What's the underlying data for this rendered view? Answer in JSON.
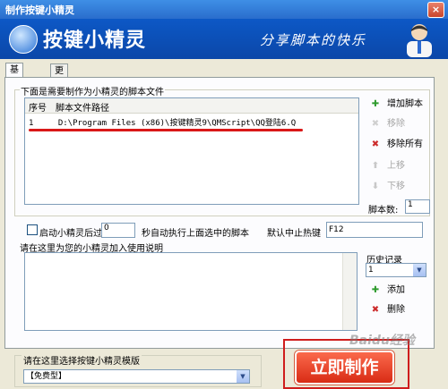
{
  "window": {
    "title": "制作按键小精灵",
    "close_glyph": "×"
  },
  "banner": {
    "app_name": "按键小精灵",
    "slogan": "分享脚本的快乐"
  },
  "tabs": [
    {
      "label": "基本信息",
      "active": true
    },
    {
      "label": "更多设置",
      "active": false
    }
  ],
  "scripts": {
    "group_title": "下面是需要制作为小精灵的脚本文件",
    "columns": [
      "序号",
      "脚本文件路径"
    ],
    "rows": [
      {
        "index": "1",
        "path": "D:\\Program Files (x86)\\按键精灵9\\QMScript\\QQ登陆6.Q"
      }
    ]
  },
  "actions": {
    "add": "增加脚本",
    "remove": "移除",
    "remove_all": "移除所有",
    "up": "上移",
    "down": "下移",
    "icons": {
      "add": "plus-icon",
      "remove": "remove-icon",
      "remove_all": "remove-all-icon",
      "up": "arrow-up-icon",
      "down": "arrow-down-icon"
    }
  },
  "script_count": {
    "label": "脚本数:",
    "value": "1"
  },
  "auto_start": {
    "label": "启动小精灵后过",
    "delay": "0",
    "suffix": "秒自动执行上面选中的脚本",
    "checked": false
  },
  "hotkey": {
    "label": "默认中止热键",
    "value": "F12"
  },
  "description": {
    "label": "请在这里为您的小精灵加入使用说明",
    "value": ""
  },
  "history": {
    "label": "历史记录",
    "selected": "1",
    "add": "添加",
    "delete": "删除"
  },
  "template": {
    "label": "请在这里选择按键小精灵模版",
    "selected": "【免费型】"
  },
  "make_button": "立即制作",
  "watermark": "Baidu经验",
  "colors": {
    "accent_red": "#d82b15",
    "title_blue": "#2a6dcc",
    "banner_blue": "#0b47a8"
  }
}
